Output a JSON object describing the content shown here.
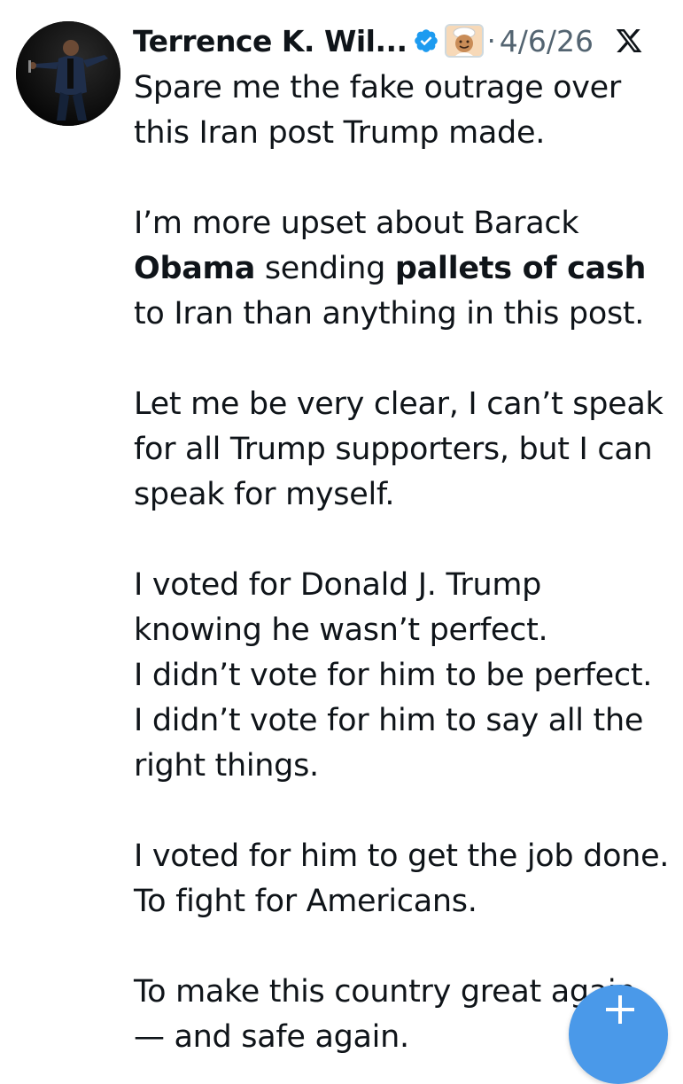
{
  "post": {
    "author_name": "Terrence K. Wil...",
    "date_separator": "·",
    "date": "4/6/26",
    "lines": [
      {
        "segments": [
          {
            "text": "Spare me the fake outrage over",
            "bold": false
          }
        ]
      },
      {
        "segments": [
          {
            "text": "this Iran post Trump made.",
            "bold": false
          }
        ]
      },
      {
        "segments": []
      },
      {
        "segments": [
          {
            "text": "I’m more upset about Barack",
            "bold": false
          }
        ]
      },
      {
        "segments": [
          {
            "text": "Obama",
            "bold": true
          },
          {
            "text": " sending ",
            "bold": false
          },
          {
            "text": "pallets of cash",
            "bold": true
          }
        ]
      },
      {
        "segments": [
          {
            "text": "to Iran than anything in this post.",
            "bold": false
          }
        ]
      },
      {
        "segments": []
      },
      {
        "segments": [
          {
            "text": "Let me be very clear, I can’t speak",
            "bold": false
          }
        ]
      },
      {
        "segments": [
          {
            "text": "for all Trump supporters, but I can",
            "bold": false
          }
        ]
      },
      {
        "segments": [
          {
            "text": "speak for myself.",
            "bold": false
          }
        ]
      },
      {
        "segments": []
      },
      {
        "segments": [
          {
            "text": "I voted for Donald J. Trump",
            "bold": false
          }
        ]
      },
      {
        "segments": [
          {
            "text": "knowing he wasn’t perfect.",
            "bold": false
          }
        ]
      },
      {
        "segments": [
          {
            "text": "I didn’t vote for him to be perfect.",
            "bold": false
          }
        ]
      },
      {
        "segments": [
          {
            "text": "I didn’t vote for him to say all the",
            "bold": false
          }
        ]
      },
      {
        "segments": [
          {
            "text": "right things.",
            "bold": false
          }
        ]
      },
      {
        "segments": []
      },
      {
        "segments": [
          {
            "text": "I voted for him to get the job done.",
            "bold": false
          }
        ]
      },
      {
        "segments": [
          {
            "text": "To fight for Americans.",
            "bold": false
          }
        ]
      },
      {
        "segments": []
      },
      {
        "segments": [
          {
            "text": "To make this country great again",
            "bold": false
          }
        ]
      },
      {
        "segments": [
          {
            "text": "— and safe again.",
            "bold": false
          }
        ]
      }
    ]
  },
  "icons": {
    "verified": "verified-badge-icon",
    "affiliate": "affiliate-badge-icon",
    "platform": "x-logo-icon",
    "compose": "plus-icon"
  },
  "colors": {
    "text": "#0f1419",
    "muted": "#536471",
    "verified_blue": "#1d9bf0",
    "fab_blue": "#4a99e9"
  }
}
